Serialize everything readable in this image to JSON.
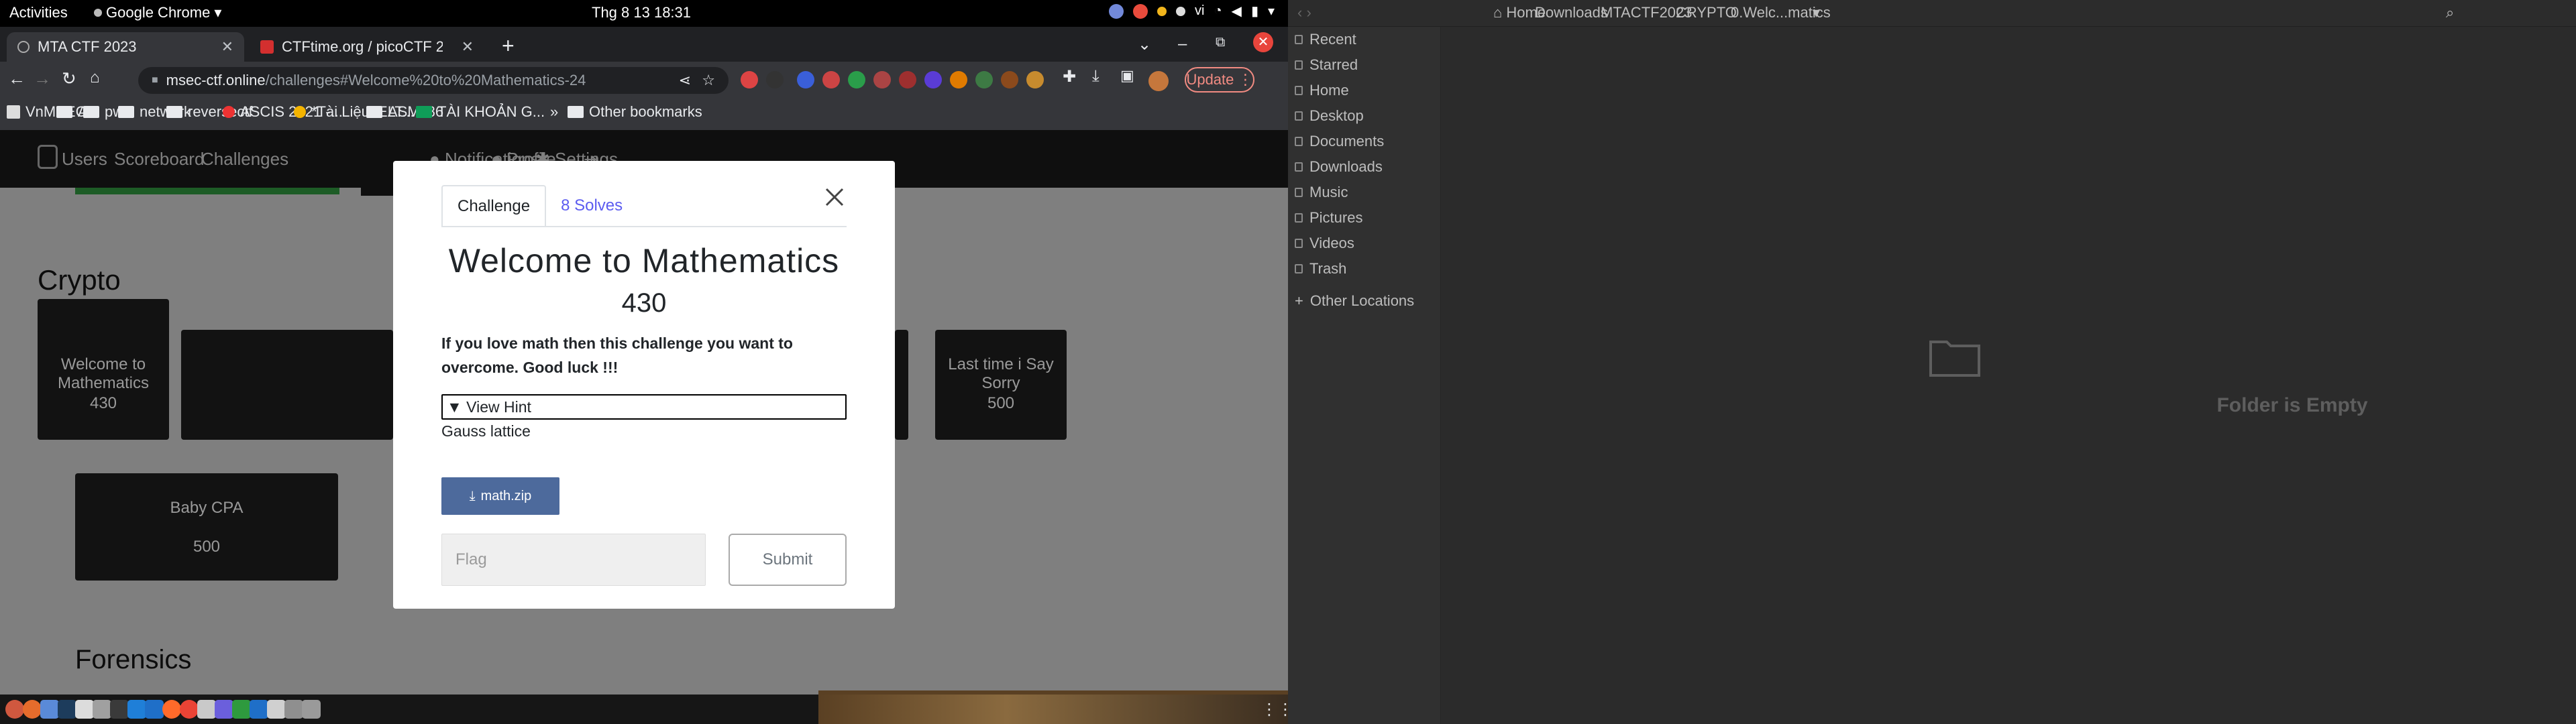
{
  "topbar": {
    "activities": "Activities",
    "app": "Google Chrome",
    "clock": "Thg 8 13  18:31",
    "lang": "vi"
  },
  "browser": {
    "tabs": [
      {
        "label": "MTA CTF 2023"
      },
      {
        "label": "CTFtime.org / picoCTF 20"
      }
    ],
    "url_host": "msec-ctf.online",
    "url_path": "/challenges#Welcome%20to%20Mathematics-24",
    "update_label": "Update",
    "bookmarks": [
      "VnMSEC",
      "AI",
      "pwn",
      "network",
      "reversectf",
      "ASCIS 2021 -...",
      "*Tài Liệu IELT...",
      "ASMx86",
      "TÀI KHOẢN G...",
      "»",
      "Other bookmarks"
    ]
  },
  "ctf": {
    "nav": [
      "Users",
      "Scoreboard",
      "Challenges",
      "Notifications",
      "Profile",
      "Settings"
    ],
    "sections": {
      "crypto": "Crypto",
      "forensics": "Forensics"
    },
    "cards": [
      {
        "title": "Welcome to Mathematics",
        "value": "430"
      },
      {
        "title": "Last time i Say Sorry",
        "value": "500"
      },
      {
        "title": "Baby CPA",
        "value": "500"
      }
    ]
  },
  "modal": {
    "tab_challenge": "Challenge",
    "tab_solves": "8 Solves",
    "title": "Welcome to Mathematics",
    "value": "430",
    "description": "If you love math then this challenge you want to overcome. Good luck !!!",
    "hint_label": "▼ View Hint",
    "hint_text": "Gauss lattice",
    "file_label": "math.zip",
    "flag_placeholder": "Flag",
    "submit_label": "Submit"
  },
  "files": {
    "breadcrumbs": [
      "Home",
      "Downloads",
      "MTACTF2023",
      "CRYPTO",
      "0.Welc...matics"
    ],
    "sidebar": [
      "Recent",
      "Starred",
      "Home",
      "Desktop",
      "Documents",
      "Downloads",
      "Music",
      "Pictures",
      "Videos",
      "Trash",
      "Other Locations"
    ],
    "empty_text": "Folder is Empty"
  },
  "colors": {
    "accent_link": "#5c5cf0",
    "download_button": "#4d6a9c",
    "update_button": "#f28b82"
  }
}
